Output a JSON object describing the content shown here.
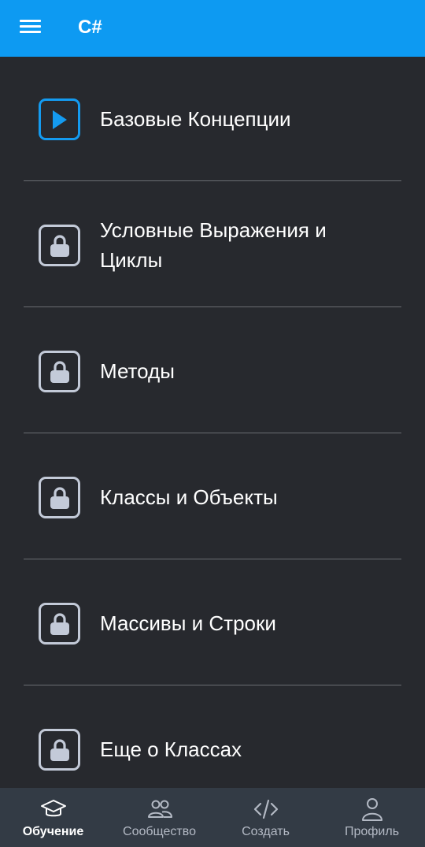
{
  "appbar": {
    "title": "C#",
    "menu_icon": "hamburger-menu-icon",
    "background": "#0d9af2"
  },
  "lessons": [
    {
      "label": "Базовые Концепции",
      "status": "unlocked",
      "icon": "play-icon"
    },
    {
      "label": "Условные Выражения и Циклы",
      "status": "locked",
      "icon": "lock-icon"
    },
    {
      "label": "Методы",
      "status": "locked",
      "icon": "lock-icon"
    },
    {
      "label": "Классы и Объекты",
      "status": "locked",
      "icon": "lock-icon"
    },
    {
      "label": "Массивы и Строки",
      "status": "locked",
      "icon": "lock-icon"
    },
    {
      "label": "Еще о Классах",
      "status": "locked",
      "icon": "lock-icon"
    }
  ],
  "bottom_nav": {
    "items": [
      {
        "label": "Обучение",
        "icon": "graduation-cap-icon",
        "active": true
      },
      {
        "label": "Сообщество",
        "icon": "community-icon",
        "active": false
      },
      {
        "label": "Создать",
        "icon": "code-icon",
        "active": false
      },
      {
        "label": "Профиль",
        "icon": "profile-icon",
        "active": false
      }
    ]
  },
  "colors": {
    "accent": "#149bf0",
    "background": "#27292e",
    "nav_background": "#333b45",
    "locked_icon": "#c3cad8"
  }
}
